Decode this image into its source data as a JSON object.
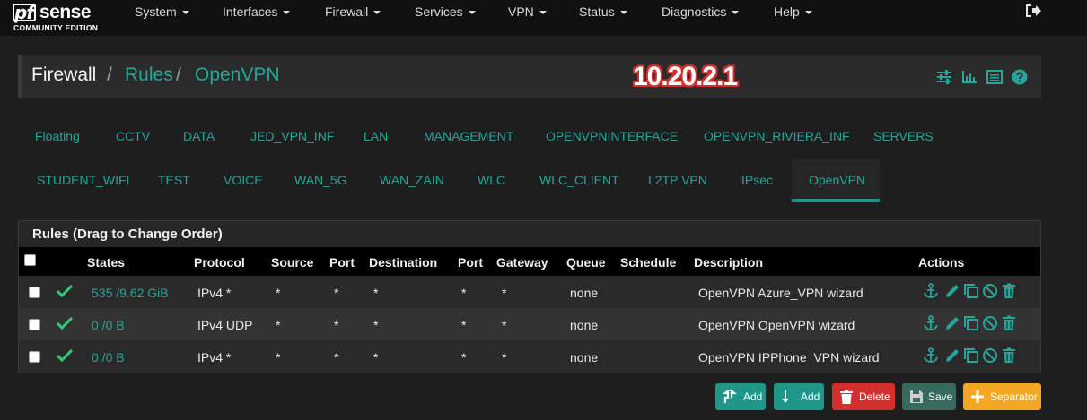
{
  "brand": {
    "logo_main": "sense",
    "logo_prefix": "pf",
    "logo_sub": "COMMUNITY EDITION"
  },
  "nav": [
    "System",
    "Interfaces",
    "Firewall",
    "Services",
    "VPN",
    "Status",
    "Diagnostics",
    "Help"
  ],
  "breadcrumb": {
    "root": "Firewall",
    "sep": "/",
    "level2": "Rules",
    "level3": "OpenVPN"
  },
  "ip_overlay": "10.20.2.1",
  "tabs_row1": [
    "Floating",
    "CCTV",
    "DATA",
    "JED_VPN_INF",
    "LAN",
    "MANAGEMENT",
    "OPENVPNINTERFACE",
    "OPENVPN_RIVIERA_INF",
    "SERVERS"
  ],
  "tabs_row2": [
    "STUDENT_WIFI",
    "TEST",
    "VOICE",
    "WAN_5G",
    "WAN_ZAIN",
    "WLC",
    "WLC_CLIENT",
    "L2TP VPN",
    "IPsec",
    "OpenVPN"
  ],
  "active_tab": "OpenVPN",
  "panel": {
    "title": "Rules (Drag to Change Order)",
    "headers": [
      "States",
      "Protocol",
      "Source",
      "Port",
      "Destination",
      "Port",
      "Gateway",
      "Queue",
      "Schedule",
      "Description",
      "Actions"
    ]
  },
  "rows": [
    {
      "states": "535 /9.62 GiB",
      "protocol": "IPv4 *",
      "source": "*",
      "sport": "*",
      "destination": "*",
      "dport": "*",
      "gateway": "*",
      "queue": "none",
      "schedule": "",
      "description": "OpenVPN Azure_VPN wizard"
    },
    {
      "states": "0 /0 B",
      "protocol": "IPv4 UDP",
      "source": "*",
      "sport": "*",
      "destination": "*",
      "dport": "*",
      "gateway": "*",
      "queue": "none",
      "schedule": "",
      "description": "OpenVPN OpenVPN wizard"
    },
    {
      "states": "0 /0 B",
      "protocol": "IPv4 *",
      "source": "*",
      "sport": "*",
      "destination": "*",
      "dport": "*",
      "gateway": "*",
      "queue": "none",
      "schedule": "",
      "description": "OpenVPN IPPhone_VPN wizard"
    }
  ],
  "buttons": {
    "add_top": "Add",
    "add_bottom": "Add",
    "delete": "Delete",
    "save": "Save",
    "separator": "Separator"
  },
  "colors": {
    "accent": "#26a69a",
    "navbar": "#101010",
    "delete": "#d32f2f",
    "save": "#37695f",
    "separator": "#f5a623",
    "ip_outline": "#d32f2f"
  }
}
